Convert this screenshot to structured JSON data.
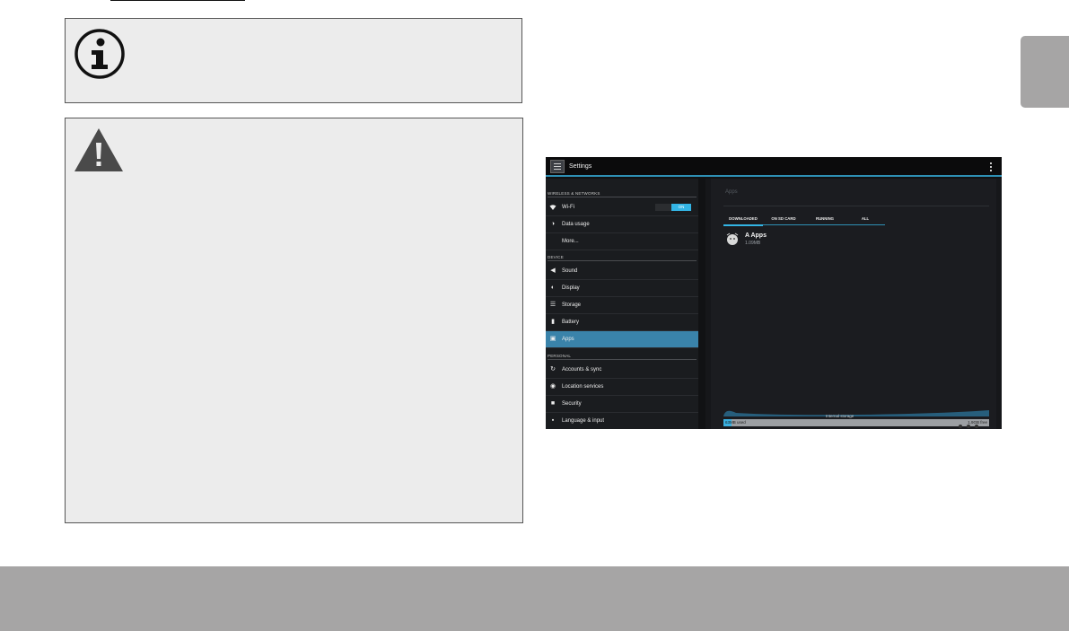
{
  "android": {
    "title": "Settings",
    "sections": [
      {
        "header": "WIRELESS & NETWORKS"
      },
      {
        "header": "DEVICE"
      },
      {
        "header": "PERSONAL"
      }
    ],
    "items": [
      {
        "label": "Wi-Fi",
        "icon": "wifi-icon",
        "toggle": "ON"
      },
      {
        "label": "Data usage",
        "icon": "data-usage-icon"
      },
      {
        "label": "More...",
        "icon": ""
      },
      {
        "label": "Sound",
        "icon": "sound-icon"
      },
      {
        "label": "Display",
        "icon": "display-icon"
      },
      {
        "label": "Storage",
        "icon": "storage-icon"
      },
      {
        "label": "Battery",
        "icon": "battery-icon"
      },
      {
        "label": "Apps",
        "icon": "apps-icon",
        "selected": true
      },
      {
        "label": "Accounts & sync",
        "icon": "sync-icon"
      },
      {
        "label": "Location services",
        "icon": "location-icon"
      },
      {
        "label": "Security",
        "icon": "lock-icon"
      },
      {
        "label": "Language & input",
        "icon": "language-icon"
      }
    ],
    "apps_pane": {
      "heading": "Apps",
      "tabs": [
        "DOWNLOADED",
        "ON SD CARD",
        "RUNNING",
        "ALL"
      ],
      "active_tab": "DOWNLOADED",
      "app": {
        "name": "A Apps",
        "size": "1.09MB"
      },
      "storage": {
        "label": "Internal storage",
        "used": "63MB used",
        "free": "1.9GB free",
        "used_fraction": 0.03
      }
    }
  },
  "colors": {
    "accent": "#33b5e5",
    "selected_row": "#3a83aa",
    "box_background": "#ececec",
    "band_gray": "#a6a5a5"
  }
}
